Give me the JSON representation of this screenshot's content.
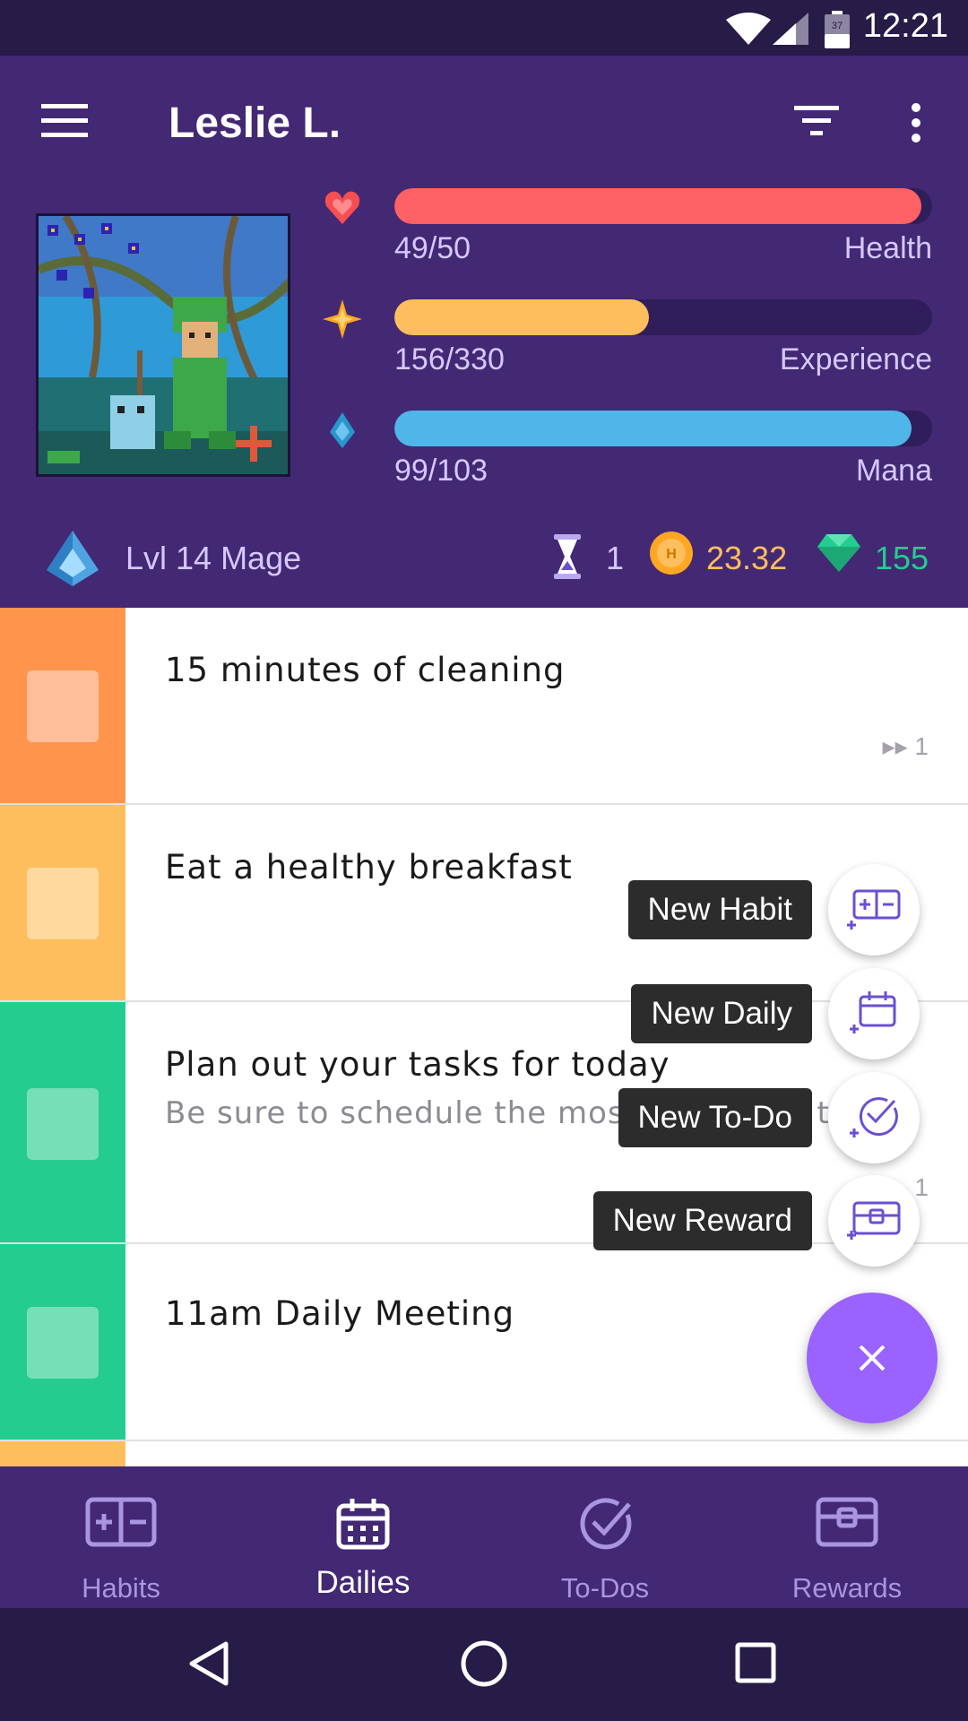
{
  "status_bar": {
    "time": "12:21",
    "battery_level": "37"
  },
  "header": {
    "title": "Leslie L."
  },
  "stats": [
    {
      "name": "health",
      "value": "49/50",
      "label": "Health",
      "fraction": 0.98,
      "color": "#ff6165"
    },
    {
      "name": "experience",
      "value": "156/330",
      "label": "Experience",
      "fraction": 0.473,
      "color": "#ffbe5d"
    },
    {
      "name": "mana",
      "value": "99/103",
      "label": "Mana",
      "fraction": 0.961,
      "color": "#50b5e9"
    }
  ],
  "user": {
    "level": "Lvl 14 Mage",
    "hourglasses": "1",
    "gold": "23.32",
    "gems": "155"
  },
  "tasks": [
    {
      "title": "15 minutes of cleaning",
      "note": "",
      "streak": "1",
      "color": "#ff944c",
      "check_color": "#ffbe9a"
    },
    {
      "title": "Eat a healthy breakfast",
      "note": "",
      "streak": "",
      "color": "#ffbe5d",
      "check_color": "#ffd99e"
    },
    {
      "title": "Plan out your tasks for today",
      "note": "Be sure to schedule the most important tasks",
      "streak": "1",
      "color": "#24cc8f",
      "check_color": "#77dfb6"
    },
    {
      "title": "11am Daily Meeting",
      "note": "",
      "streak": "",
      "color": "#24cc8f",
      "check_color": "#77dfb6"
    }
  ],
  "fab_menu": [
    {
      "label": "New Habit",
      "icon": "new-habit-icon"
    },
    {
      "label": "New Daily",
      "icon": "new-daily-icon"
    },
    {
      "label": "New To-Do",
      "icon": "new-todo-icon"
    },
    {
      "label": "New Reward",
      "icon": "new-reward-icon"
    }
  ],
  "fab_main_icon": "close-icon",
  "bottom_nav": [
    {
      "label": "Habits",
      "icon": "habits-icon",
      "active": false
    },
    {
      "label": "Dailies",
      "icon": "dailies-icon",
      "active": true
    },
    {
      "label": "To-Dos",
      "icon": "todos-icon",
      "active": false
    },
    {
      "label": "Rewards",
      "icon": "rewards-icon",
      "active": false
    }
  ],
  "colors": {
    "header_bg": "#432874",
    "status_bg": "#271b47",
    "accent": "#9a62ff"
  }
}
